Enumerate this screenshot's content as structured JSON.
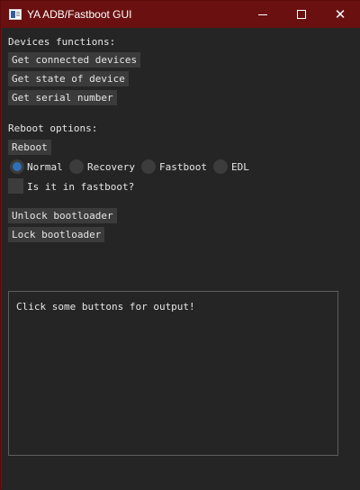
{
  "window": {
    "title": "YA ADB/Fastboot GUI",
    "minimize_glyph": "",
    "close_glyph": "✕"
  },
  "devices": {
    "heading": "Devices functions:",
    "buttons": [
      "Get connected devices",
      "Get state of device",
      "Get serial number"
    ]
  },
  "reboot": {
    "heading": "Reboot options:",
    "button": "Reboot",
    "modes": [
      {
        "label": "Normal",
        "checked": true
      },
      {
        "label": "Recovery",
        "checked": false
      },
      {
        "label": "Fastboot",
        "checked": false
      },
      {
        "label": "EDL",
        "checked": false
      }
    ],
    "fastboot_check_label": "Is it in fastboot?",
    "fastboot_checked": false
  },
  "bootloader": {
    "unlock_label": "Unlock bootloader",
    "lock_label": "Lock bootloader"
  },
  "output": {
    "text": "Click some buttons for output!"
  },
  "colors": {
    "titlebar": "#6b1010",
    "background": "#252525",
    "button": "#3b3b3b",
    "radio_accent": "#2f6fb8"
  }
}
